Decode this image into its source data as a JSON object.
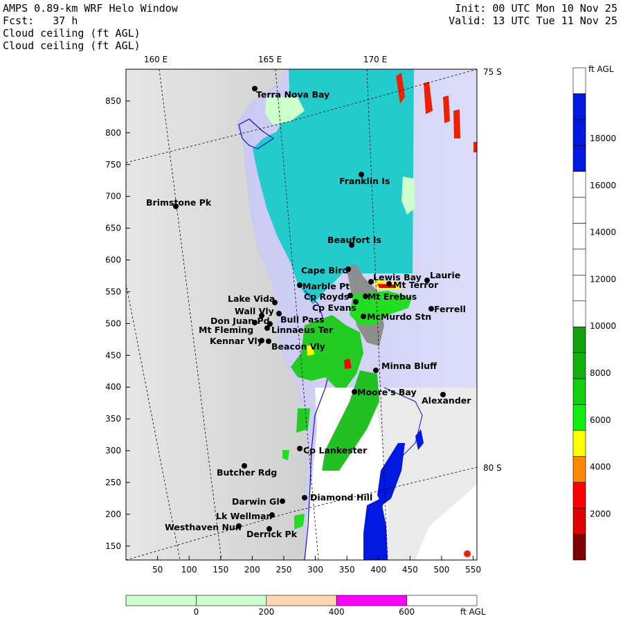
{
  "header": {
    "line1": "AMPS 0.89-km WRF Helo Window",
    "line2": "Fcst:   37 h",
    "line3": "Cloud ceiling (ft AGL)",
    "line4": "Cloud ceiling (ft AGL)",
    "init": "Init: 00 UTC Mon 10 Nov 25",
    "valid": "Valid: 13 UTC Tue 11 Nov 25"
  },
  "map": {
    "longitude_labels": [
      "160 E",
      "165 E",
      "170 E"
    ],
    "latitude_labels": [
      "75 S",
      "80 S"
    ],
    "x_ticks": [
      "50",
      "100",
      "150",
      "200",
      "250",
      "300",
      "350",
      "400",
      "450",
      "500",
      "550"
    ],
    "y_ticks": [
      "850",
      "800",
      "750",
      "700",
      "650",
      "600",
      "550",
      "500",
      "450",
      "400",
      "350",
      "300",
      "250",
      "200",
      "150"
    ],
    "stations": [
      {
        "name": "Terra Nova Bay"
      },
      {
        "name": "Franklin Is"
      },
      {
        "name": "Brimstone Pk"
      },
      {
        "name": "Beaufort Is"
      },
      {
        "name": "Cape Bird"
      },
      {
        "name": "Lewis Bay"
      },
      {
        "name": "Laurie"
      },
      {
        "name": "Mt Terror"
      },
      {
        "name": "Marble Pt"
      },
      {
        "name": "Cp Royds"
      },
      {
        "name": "Mt Erebus"
      },
      {
        "name": "Lake Vida"
      },
      {
        "name": "Cp Evans"
      },
      {
        "name": "Ferrell"
      },
      {
        "name": "Wall Vly"
      },
      {
        "name": "McMurdo Stn"
      },
      {
        "name": "Bull Pass"
      },
      {
        "name": "Don Juan Pd"
      },
      {
        "name": "Mt Fleming"
      },
      {
        "name": "Linnaeus Ter"
      },
      {
        "name": "Kennar Vly"
      },
      {
        "name": "Beacon Vly"
      },
      {
        "name": "Minna Bluff"
      },
      {
        "name": "Moore's Bay"
      },
      {
        "name": "Alexander"
      },
      {
        "name": "Cp Lankester"
      },
      {
        "name": "Butcher Rdg"
      },
      {
        "name": "Diamond Hill"
      },
      {
        "name": "Darwin Gl"
      },
      {
        "name": "Lk Wellman"
      },
      {
        "name": "Westhaven Nun"
      },
      {
        "name": "Derrick Pk"
      }
    ]
  },
  "colorbar_right": {
    "unit": "ft AGL",
    "labels": [
      "18000",
      "16000",
      "14000",
      "12000",
      "10000",
      "8000",
      "6000",
      "4000",
      "2000"
    ],
    "colors": [
      "#ffffff",
      "#0018e0",
      "#0018e0",
      "#0018e0",
      "#ffffff",
      "#ffffff",
      "#ffffff",
      "#ffffff",
      "#ffffff",
      "#ffffff",
      "#10a010",
      "#10b010",
      "#10d010",
      "#10ee10",
      "#ffff00",
      "#ff8800",
      "#ff0000",
      "#e00000",
      "#800000"
    ]
  },
  "colorbar_bottom": {
    "unit": "ft AGL",
    "labels": [
      "0",
      "200",
      "400",
      "600"
    ],
    "colors": [
      "#ccffcc",
      "#ccffcc",
      "#ffd8b0",
      "#ff00ff",
      "#ffffff"
    ]
  }
}
